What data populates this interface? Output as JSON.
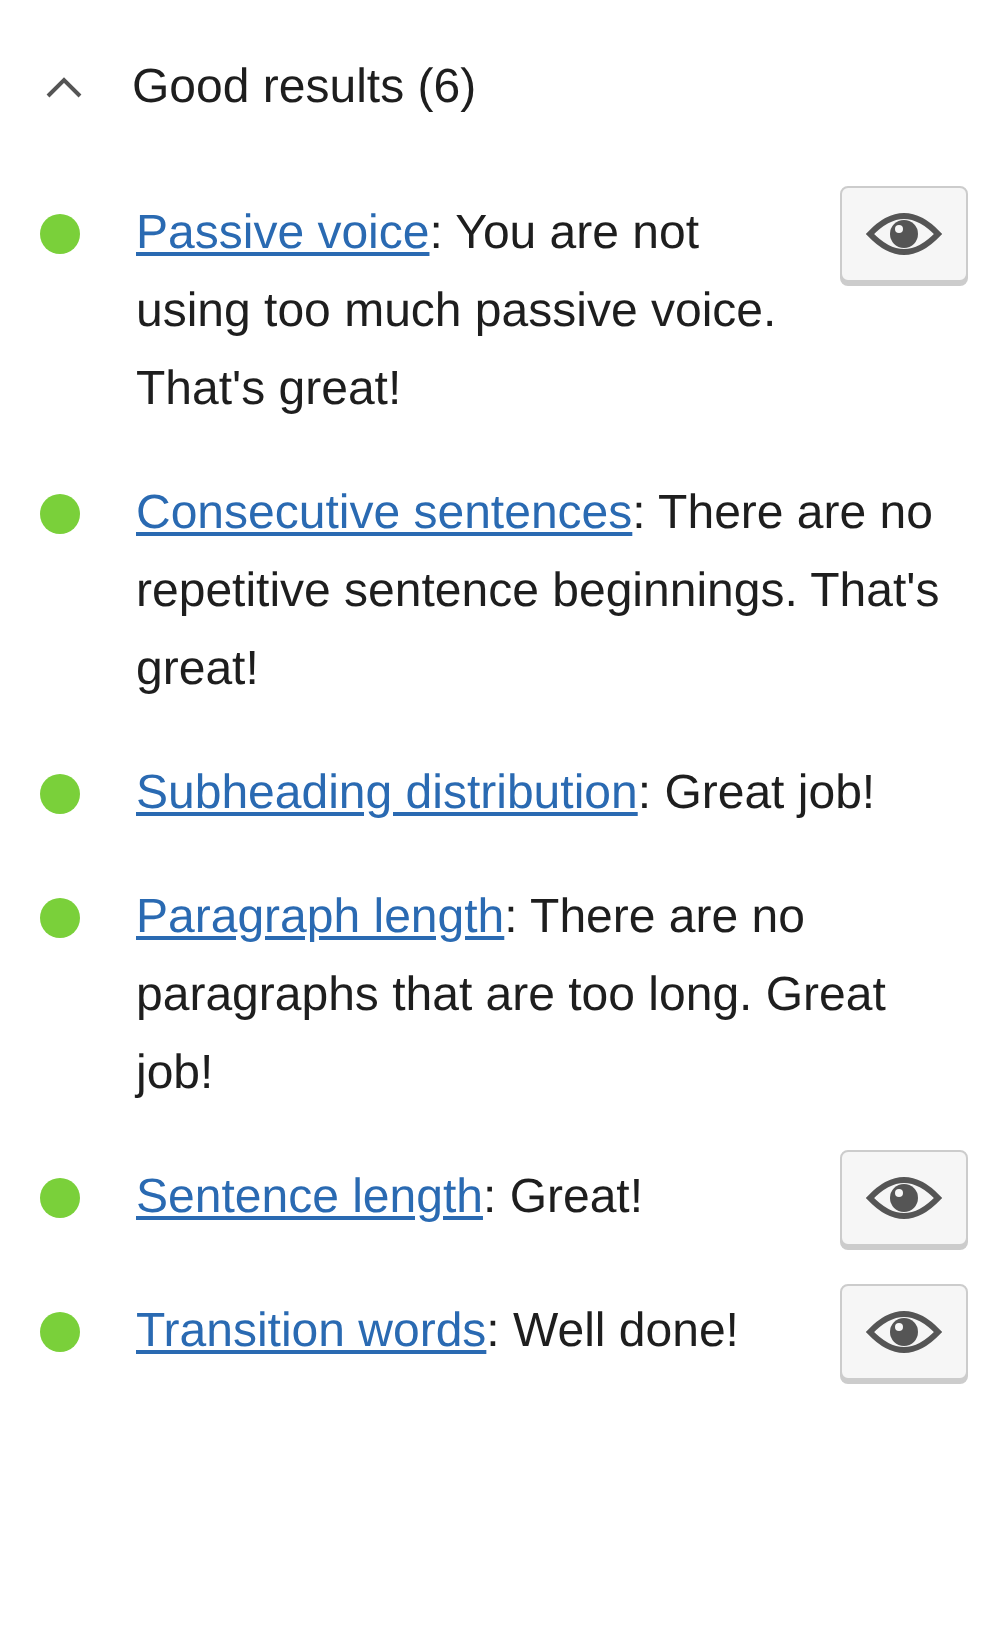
{
  "section": {
    "title": "Good results (6)",
    "expanded": true
  },
  "results": [
    {
      "link": "Passive voice",
      "text": ": You are not using too much passive voice. That's great!",
      "color": "#7ad03a",
      "has_eye_button": true
    },
    {
      "link": "Consecutive sentences",
      "text": ": There are no repetitive sentence beginnings. That's great!",
      "color": "#7ad03a",
      "has_eye_button": false
    },
    {
      "link": "Subheading distribution",
      "text": ": Great job!",
      "color": "#7ad03a",
      "has_eye_button": false
    },
    {
      "link": "Paragraph length",
      "text": ": There are no paragraphs that are too long. Great job!",
      "color": "#7ad03a",
      "has_eye_button": false
    },
    {
      "link": "Sentence length",
      "text": ": Great!",
      "color": "#7ad03a",
      "has_eye_button": true
    },
    {
      "link": "Transition words",
      "text": ": Well done!",
      "color": "#7ad03a",
      "has_eye_button": true
    }
  ]
}
